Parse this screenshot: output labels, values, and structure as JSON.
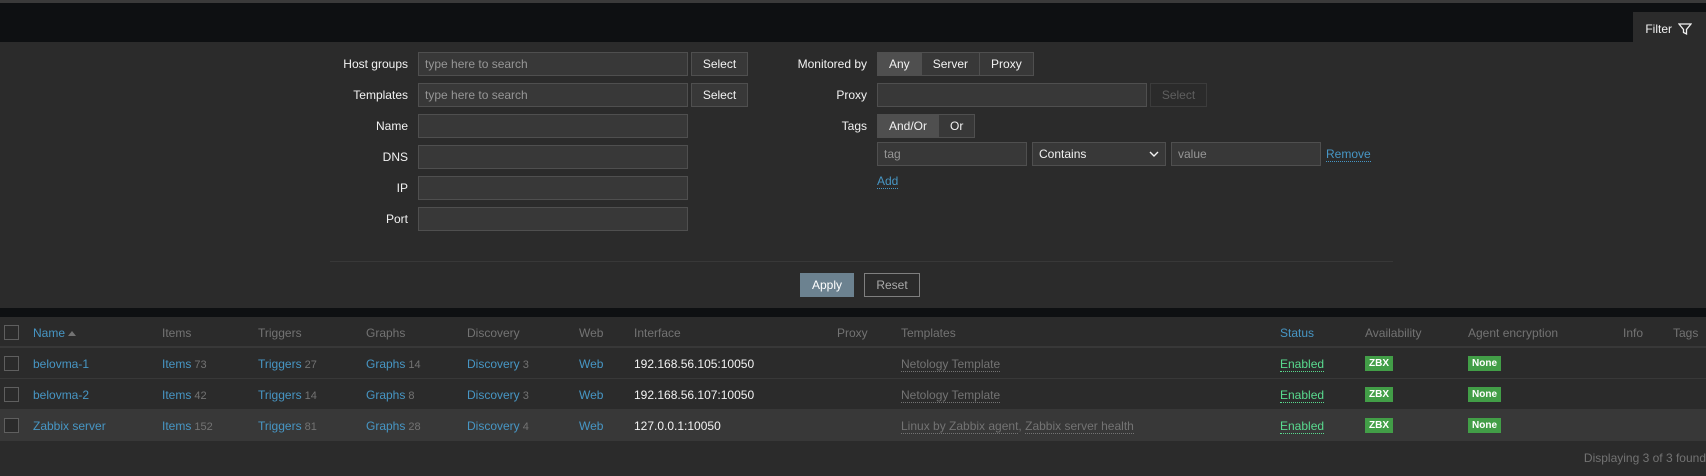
{
  "filter_tab": {
    "label": "Filter"
  },
  "filter": {
    "host_groups": {
      "label": "Host groups",
      "placeholder": "type here to search",
      "select": "Select"
    },
    "templates": {
      "label": "Templates",
      "placeholder": "type here to search",
      "select": "Select"
    },
    "name": {
      "label": "Name",
      "value": ""
    },
    "dns": {
      "label": "DNS",
      "value": ""
    },
    "ip": {
      "label": "IP",
      "value": ""
    },
    "port": {
      "label": "Port",
      "value": ""
    },
    "monitored_by": {
      "label": "Monitored by",
      "options": [
        "Any",
        "Server",
        "Proxy"
      ],
      "selected": "Any"
    },
    "proxy": {
      "label": "Proxy",
      "select": "Select"
    },
    "tags": {
      "label": "Tags",
      "options": [
        "And/Or",
        "Or"
      ],
      "selected": "And/Or",
      "tag_placeholder": "tag",
      "operator": "Contains",
      "value_placeholder": "value",
      "remove": "Remove",
      "add": "Add"
    },
    "apply": "Apply",
    "reset": "Reset"
  },
  "table": {
    "headers": {
      "name": "Name",
      "items": "Items",
      "triggers": "Triggers",
      "graphs": "Graphs",
      "discovery": "Discovery",
      "web": "Web",
      "interface": "Interface",
      "proxy": "Proxy",
      "templates": "Templates",
      "status": "Status",
      "availability": "Availability",
      "agent_encryption": "Agent encryption",
      "info": "Info",
      "tags": "Tags"
    },
    "rows": [
      {
        "name": "belovma-1",
        "items_label": "Items",
        "items_count": "73",
        "triggers_label": "Triggers",
        "triggers_count": "27",
        "graphs_label": "Graphs",
        "graphs_count": "14",
        "discovery_label": "Discovery",
        "discovery_count": "3",
        "web": "Web",
        "interface": "192.168.56.105:10050",
        "templates": [
          "Netology Template"
        ],
        "status": "Enabled",
        "availability": "ZBX",
        "encryption": "None"
      },
      {
        "name": "belovma-2",
        "items_label": "Items",
        "items_count": "42",
        "triggers_label": "Triggers",
        "triggers_count": "14",
        "graphs_label": "Graphs",
        "graphs_count": "8",
        "discovery_label": "Discovery",
        "discovery_count": "3",
        "web": "Web",
        "interface": "192.168.56.107:10050",
        "templates": [
          "Netology Template"
        ],
        "status": "Enabled",
        "availability": "ZBX",
        "encryption": "None"
      },
      {
        "name": "Zabbix server",
        "items_label": "Items",
        "items_count": "152",
        "triggers_label": "Triggers",
        "triggers_count": "81",
        "graphs_label": "Graphs",
        "graphs_count": "28",
        "discovery_label": "Discovery",
        "discovery_count": "4",
        "web": "Web",
        "interface": "127.0.0.1:10050",
        "templates": [
          "Linux by Zabbix agent",
          "Zabbix server health"
        ],
        "status": "Enabled",
        "availability": "ZBX",
        "encryption": "None"
      }
    ],
    "template_separator": ",",
    "footer": "Displaying 3 of 3 found"
  },
  "colors": {
    "link": "#4796c4",
    "enabled": "#59db8f",
    "badge": "#429e47",
    "background": "#2b2b2b",
    "topbar": "#0e1012"
  },
  "icons": {
    "filter": "filter-icon",
    "sort": "sort-ascending-icon",
    "dropdown": "chevron-down-icon"
  }
}
